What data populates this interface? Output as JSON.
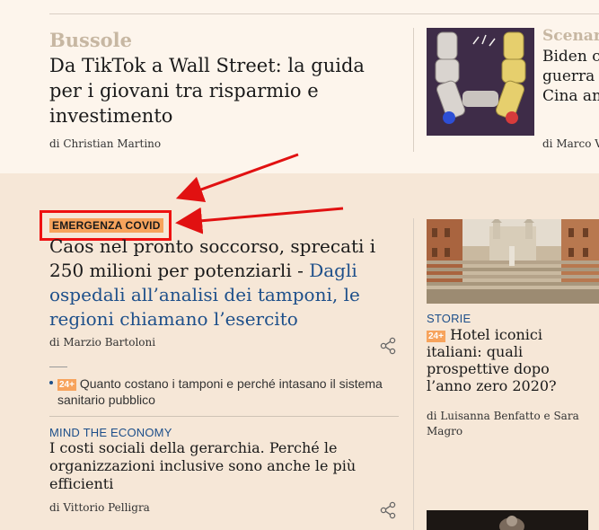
{
  "top": {
    "kicker": "Bussole",
    "title": "Da TikTok a Wall Street: la guida per i giovani tra risparmio e investimento",
    "byline": "di Christian Martino",
    "right_card": {
      "kicker": "Scenari",
      "title": "Biden e la guerra … Cina an…",
      "title_lines": [
        "Biden c",
        "guerra",
        "Cina an"
      ],
      "byline": "di Marco V"
    }
  },
  "main": {
    "kicker": "EMERGENZA COVID",
    "title": "Caos nel pronto soccorso, sprecati i 250 milioni per potenziarli",
    "separator": " - ",
    "link_text": "Dagli ospedali all’analisi dei tamponi, le regioni chiamano l’esercito",
    "byline": "di Marzio Bartoloni",
    "related": {
      "badge": "24+",
      "text": "Quanto costano i tamponi e perché intasano il sistema sanitario pubblico"
    }
  },
  "mind": {
    "kicker": "MIND THE ECONOMY",
    "title": "I costi sociali della gerarchia. Perché le organizzazioni inclusive sono anche le più efficienti",
    "byline": "di Vittorio Pelligra"
  },
  "side": {
    "kicker": "STORIE",
    "badge": "24+",
    "title": "Hotel iconici italiani: quali prospettive dopo l’anno zero 2020?",
    "byline": "di Luisanna Benfatto e Sara Magro"
  },
  "colors": {
    "background_top": "#fdf5ec",
    "background_bottom": "#f6e7d7",
    "kicker_muted": "#c7b7a2",
    "link_blue": "#1d4f8a",
    "badge_orange": "#f7a35c",
    "annotation_red": "#e11111"
  },
  "icons": [
    "share-icon",
    "share-icon"
  ]
}
